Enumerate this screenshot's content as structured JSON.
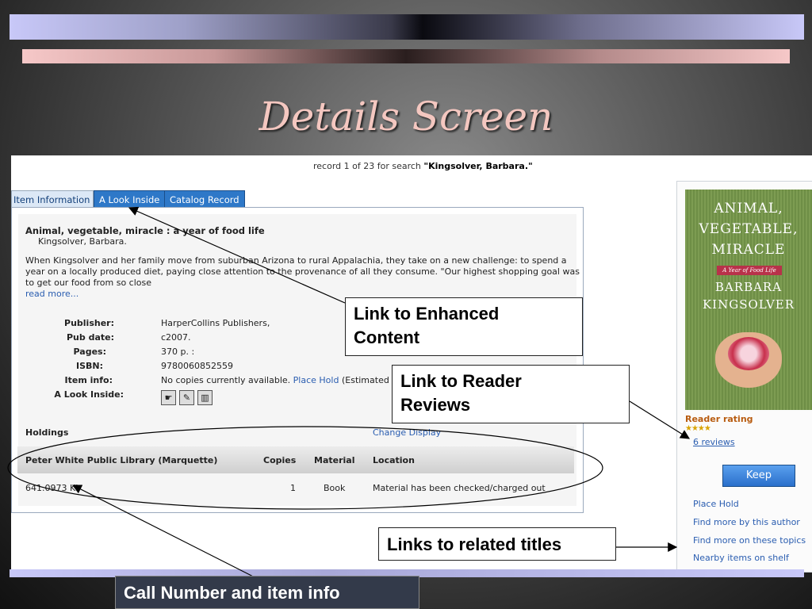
{
  "slide": {
    "title": "Details Screen"
  },
  "search": {
    "record_prefix": "record 1 of 23 for search ",
    "record_query": "\"Kingsolver, Barbara.\""
  },
  "tabs": [
    {
      "label": "Item Information",
      "active": true
    },
    {
      "label": "A Look Inside",
      "active": false
    },
    {
      "label": "Catalog Record",
      "active": false
    }
  ],
  "item": {
    "title": "Animal, vegetable, miracle : a year of food life",
    "author": "Kingsolver, Barbara.",
    "summary_lines": [
      "When Kingsolver and her family move from suburban Arizona to rural Appalachia, they take on a new challenge: to spend a",
      "year on a locally produced diet, paying close attention to the provenance of all they consume. \"Our highest shopping goal was",
      "to get our food from so close"
    ],
    "read_more": "read more...",
    "fields": {
      "publisher_label": "Publisher:",
      "publisher": "HarperCollins Publishers,",
      "pubdate_label": "Pub date:",
      "pubdate": "c2007.",
      "pages_label": "Pages:",
      "pages": "370 p. :",
      "isbn_label": "ISBN:",
      "isbn": "9780060852559",
      "iteminfo_label": "Item info:",
      "iteminfo": "No copies currently available.",
      "place_hold": "Place Hold",
      "estimated": "(Estimated w",
      "lookinside_label": "A Look Inside:"
    }
  },
  "holdings": {
    "title": "Holdings",
    "change_display": "Change Display",
    "columns": [
      "Peter White Public Library (Marquette)",
      "Copies",
      "Material",
      "Location"
    ],
    "rows": [
      {
        "call_number": "641.0973 KI",
        "copies": "1",
        "material": "Book",
        "location": "Material has been checked/charged out"
      }
    ]
  },
  "sidebar": {
    "cover": {
      "title_lines": [
        "ANIMAL,",
        "VEGETABLE,",
        "MIRACLE"
      ],
      "subtitle": "A Year of Food Life",
      "author_lines": [
        "BARBARA",
        "KINGSOLVER"
      ]
    },
    "reader_rating": "Reader rating",
    "stars": "★★★★",
    "reviews": "6 reviews",
    "keep": "Keep",
    "links": [
      "Place Hold",
      "Find more by this author",
      "Find more on these topics",
      "Nearby items on shelf"
    ]
  },
  "callouts": {
    "enhanced": [
      "Link to Enhanced",
      "Content"
    ],
    "reviews": [
      "Link to Reader",
      "Reviews"
    ],
    "related": "Links to related titles",
    "callnumber": "Call Number and item info"
  }
}
